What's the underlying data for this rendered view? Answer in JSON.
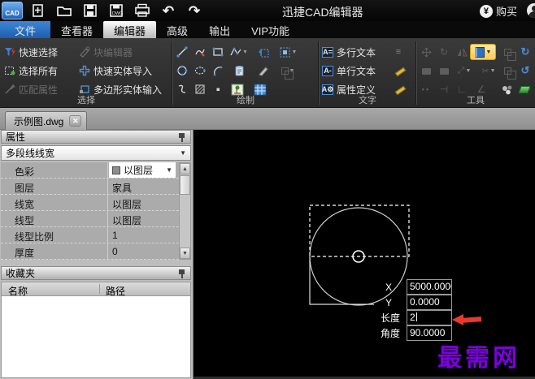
{
  "titlebar": {
    "title": "迅捷CAD编辑器",
    "buy_label": "购买"
  },
  "menubar": {
    "items": [
      "文件",
      "查看器",
      "编辑器",
      "高级",
      "输出",
      "VIP功能"
    ]
  },
  "ribbon": {
    "select": {
      "label": "选择",
      "buttons": [
        "快速选择",
        "块编辑器",
        "选择所有",
        "快速实体导入",
        "匹配属性",
        "多边形实体输入"
      ]
    },
    "draw": {
      "label": "绘制"
    },
    "text": {
      "label": "文字",
      "buttons": [
        "多行文本",
        "单行文本",
        "属性定义"
      ]
    },
    "tools": {
      "label": "工具"
    }
  },
  "tabbar": {
    "active_tab": "示例图.dwg"
  },
  "properties": {
    "title": "属性",
    "selector": "多段线线宽",
    "rows": [
      {
        "label": "色彩",
        "value": "以图层"
      },
      {
        "label": "图层",
        "value": "家具"
      },
      {
        "label": "线宽",
        "value": "以图层"
      },
      {
        "label": "线型",
        "value": "以图层"
      },
      {
        "label": "线型比例",
        "value": "1"
      },
      {
        "label": "厚度",
        "value": "0"
      }
    ]
  },
  "favorites": {
    "title": "收藏夹",
    "col_name": "名称",
    "col_path": "路径"
  },
  "canvas": {
    "coords": [
      {
        "label": "X",
        "value": "5000.0000"
      },
      {
        "label": "Y",
        "value": "0.0000"
      },
      {
        "label": "长度",
        "value": "2"
      },
      {
        "label": "角度",
        "value": "90.0000"
      }
    ],
    "watermark": "最需网"
  },
  "colors": {
    "menu_highlight_blue": "#2063b4",
    "selected_tool_yellow": "#ffc94e",
    "watermark_purple": "#7a00dd",
    "arrow_red": "#e8392f",
    "canvas_bg": "#000000"
  }
}
